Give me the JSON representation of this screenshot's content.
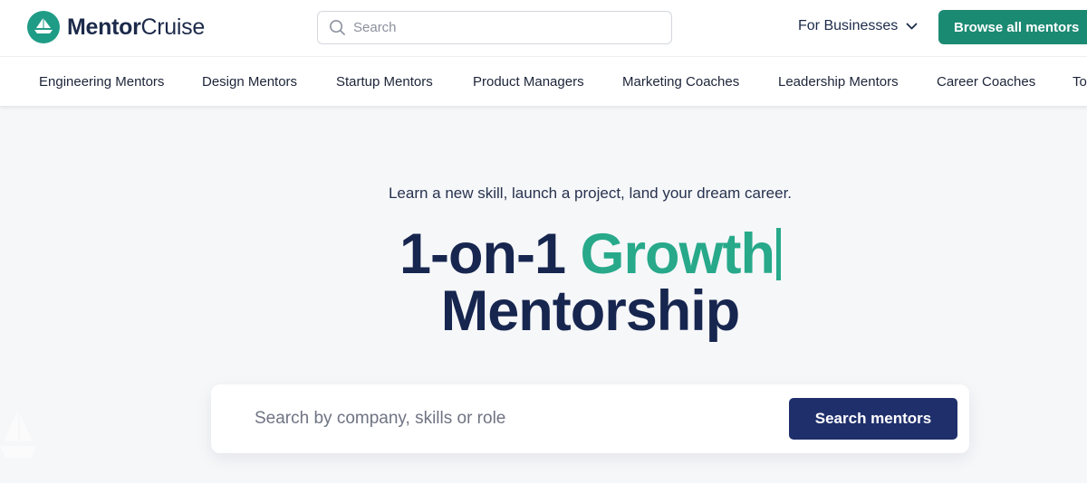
{
  "header": {
    "logo": {
      "bold": "Mentor",
      "regular": "Cruise"
    },
    "search": {
      "placeholder": "Search",
      "icon": "search-icon"
    },
    "for_businesses": {
      "label": "For Businesses",
      "icon": "chevron-down-icon"
    },
    "browse_button": "Browse all mentors"
  },
  "categories": [
    "Engineering Mentors",
    "Design Mentors",
    "Startup Mentors",
    "Product Managers",
    "Marketing Coaches",
    "Leadership Mentors",
    "Career Coaches",
    "To"
  ],
  "hero": {
    "tagline": "Learn a new skill, launch a project, land your dream career.",
    "headline_prefix": "1-on-1 ",
    "headline_highlight": "Growth",
    "headline_line2": "Mentorship",
    "search_placeholder": "Search by company, skills or role",
    "search_button": "Search mentors"
  },
  "colors": {
    "brand_green": "#1b8a73",
    "highlight_green": "#27a98a",
    "navy": "#17264f",
    "button_navy": "#1f2f6b"
  }
}
